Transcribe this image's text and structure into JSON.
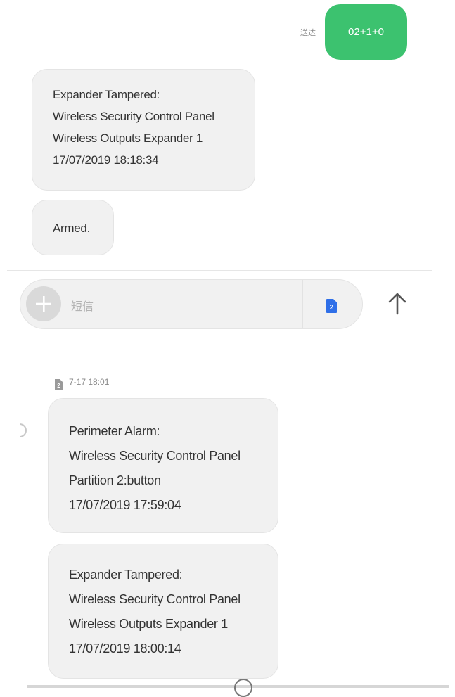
{
  "outgoing": {
    "status": "送达",
    "text": "02+1+0"
  },
  "messages_top": [
    {
      "lines": [
        "Expander Tampered:",
        "Wireless Security Control Panel",
        "Wireless Outputs Expander 1",
        "17/07/2019 18:18:34"
      ]
    },
    {
      "lines": [
        "Armed."
      ]
    }
  ],
  "composer": {
    "plus_icon": "plus-icon",
    "placeholder": "短信",
    "sim_label": "2",
    "send_icon": "arrow-up-icon"
  },
  "history": {
    "sim_label": "2",
    "timestamp": "7-17 18:01",
    "messages": [
      {
        "lines": [
          "Perimeter Alarm:",
          "Wireless Security Control Panel",
          "Partition 2:button",
          "17/07/2019 17:59:04"
        ]
      },
      {
        "lines": [
          "Expander Tampered:",
          "Wireless Security Control Panel",
          "Wireless Outputs Expander 1",
          "17/07/2019 18:00:14"
        ]
      }
    ]
  },
  "colors": {
    "sent_bubble": "#3cc26f",
    "received_bubble": "#f1f1f1",
    "sim_badge": "#2f6fe8"
  }
}
